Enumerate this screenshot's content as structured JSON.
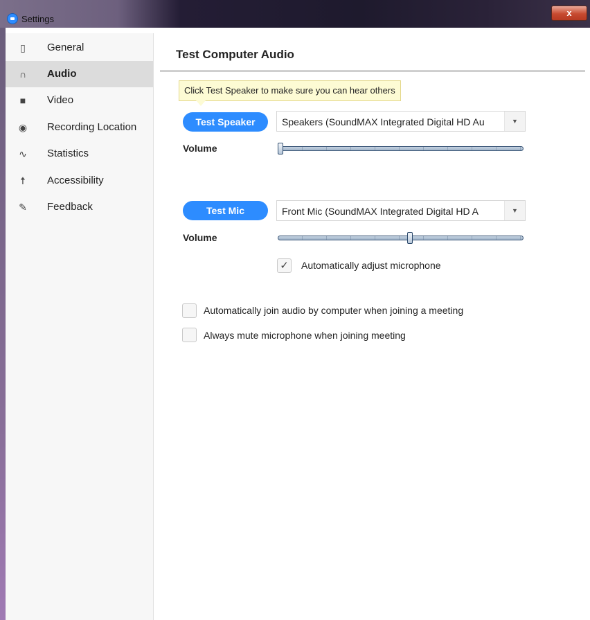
{
  "window": {
    "title": "Settings",
    "close_label": "x"
  },
  "sidebar": {
    "items": [
      {
        "label": "General",
        "icon": "phone-device-icon",
        "glyph": "▯",
        "active": false
      },
      {
        "label": "Audio",
        "icon": "headphones-icon",
        "glyph": "∩",
        "active": true
      },
      {
        "label": "Video",
        "icon": "video-camera-icon",
        "glyph": "■",
        "active": false
      },
      {
        "label": "Recording Location",
        "icon": "record-circle-icon",
        "glyph": "◉",
        "active": false
      },
      {
        "label": "Statistics",
        "icon": "pulse-icon",
        "glyph": "∿",
        "active": false
      },
      {
        "label": "Accessibility",
        "icon": "accessibility-person-icon",
        "glyph": "☨",
        "active": false
      },
      {
        "label": "Feedback",
        "icon": "feedback-pen-icon",
        "glyph": "✎",
        "active": false
      }
    ]
  },
  "main": {
    "heading": "Test Computer Audio",
    "tooltip": "Click Test Speaker to make sure you can hear others",
    "speaker": {
      "button_label": "Test Speaker",
      "device": "Speakers (SoundMAX Integrated Digital HD Au",
      "volume_label": "Volume",
      "volume_fraction": 0.0
    },
    "mic": {
      "button_label": "Test Mic",
      "device": "Front Mic (SoundMAX Integrated Digital HD A",
      "volume_label": "Volume",
      "volume_fraction": 0.54,
      "auto_adjust_label": "Automatically adjust microphone",
      "auto_adjust_checked": true
    },
    "options": [
      {
        "label": "Automatically join audio by computer when joining a meeting",
        "checked": false
      },
      {
        "label": "Always mute microphone when joining meeting",
        "checked": false
      }
    ]
  },
  "colors": {
    "accent": "#2d8cff",
    "active_row": "#dcdcdc",
    "tooltip_bg": "#fdfbd4"
  }
}
